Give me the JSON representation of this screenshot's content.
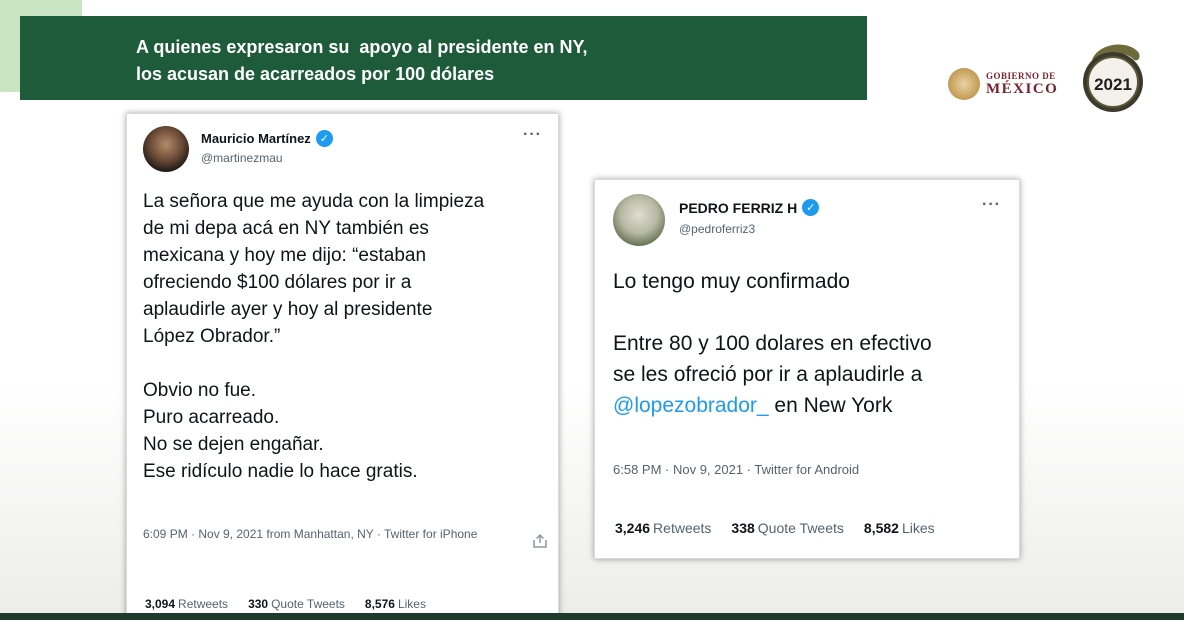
{
  "question_box": {
    "symbol": "?"
  },
  "banner": {
    "line1": "A quienes expresaron su  apoyo al presidente en NY,",
    "line2": "los acusan de acarreados por 100 dólares"
  },
  "logo": {
    "gob_line1": "GOBIERNO DE",
    "gob_line2": "MÉXICO",
    "emblem_year": "2021"
  },
  "tweets": [
    {
      "name": "Mauricio Martínez",
      "handle": "@martinezmau",
      "more": "···",
      "body": "La señora que me ayuda con la limpieza\nde mi depa acá en NY también es\nmexicana y hoy me dijo: “estaban\nofreciendo $100 dólares por ir a\naplaudirle ayer y hoy al presidente\nLópez Obrador.”\n\nObvio no fue.\nPuro acarreado.\nNo se dejen engañar.\nEse ridículo nadie lo hace gratis.",
      "meta": "6:09 PM · Nov 9, 2021 from Manhattan, NY · Twitter for iPhone",
      "retweets_count": "3,094",
      "retweets_label": "Retweets",
      "quotes_count": "330",
      "quotes_label": "Quote Tweets",
      "likes_count": "8,576",
      "likes_label": "Likes"
    },
    {
      "name": "PEDRO FERRIZ H",
      "handle": "@pedroferriz3",
      "more": "···",
      "body_part1": "Lo tengo muy confirmado\n\nEntre 80 y 100 dolares en efectivo\nse les ofreció por ir a aplaudirle a\n",
      "mention": "@lopezobrador_",
      "body_part2": " en New York",
      "meta": "6:58 PM · Nov 9, 2021 · Twitter for Android",
      "retweets_count": "3,246",
      "retweets_label": "Retweets",
      "quotes_count": "338",
      "quotes_label": "Quote Tweets",
      "likes_count": "8,582",
      "likes_label": "Likes"
    }
  ],
  "colors": {
    "banner": "#1e5b3a",
    "question_box": "#c9e4c0",
    "verified": "#1d9bf0",
    "mention": "#1d9bf0"
  }
}
